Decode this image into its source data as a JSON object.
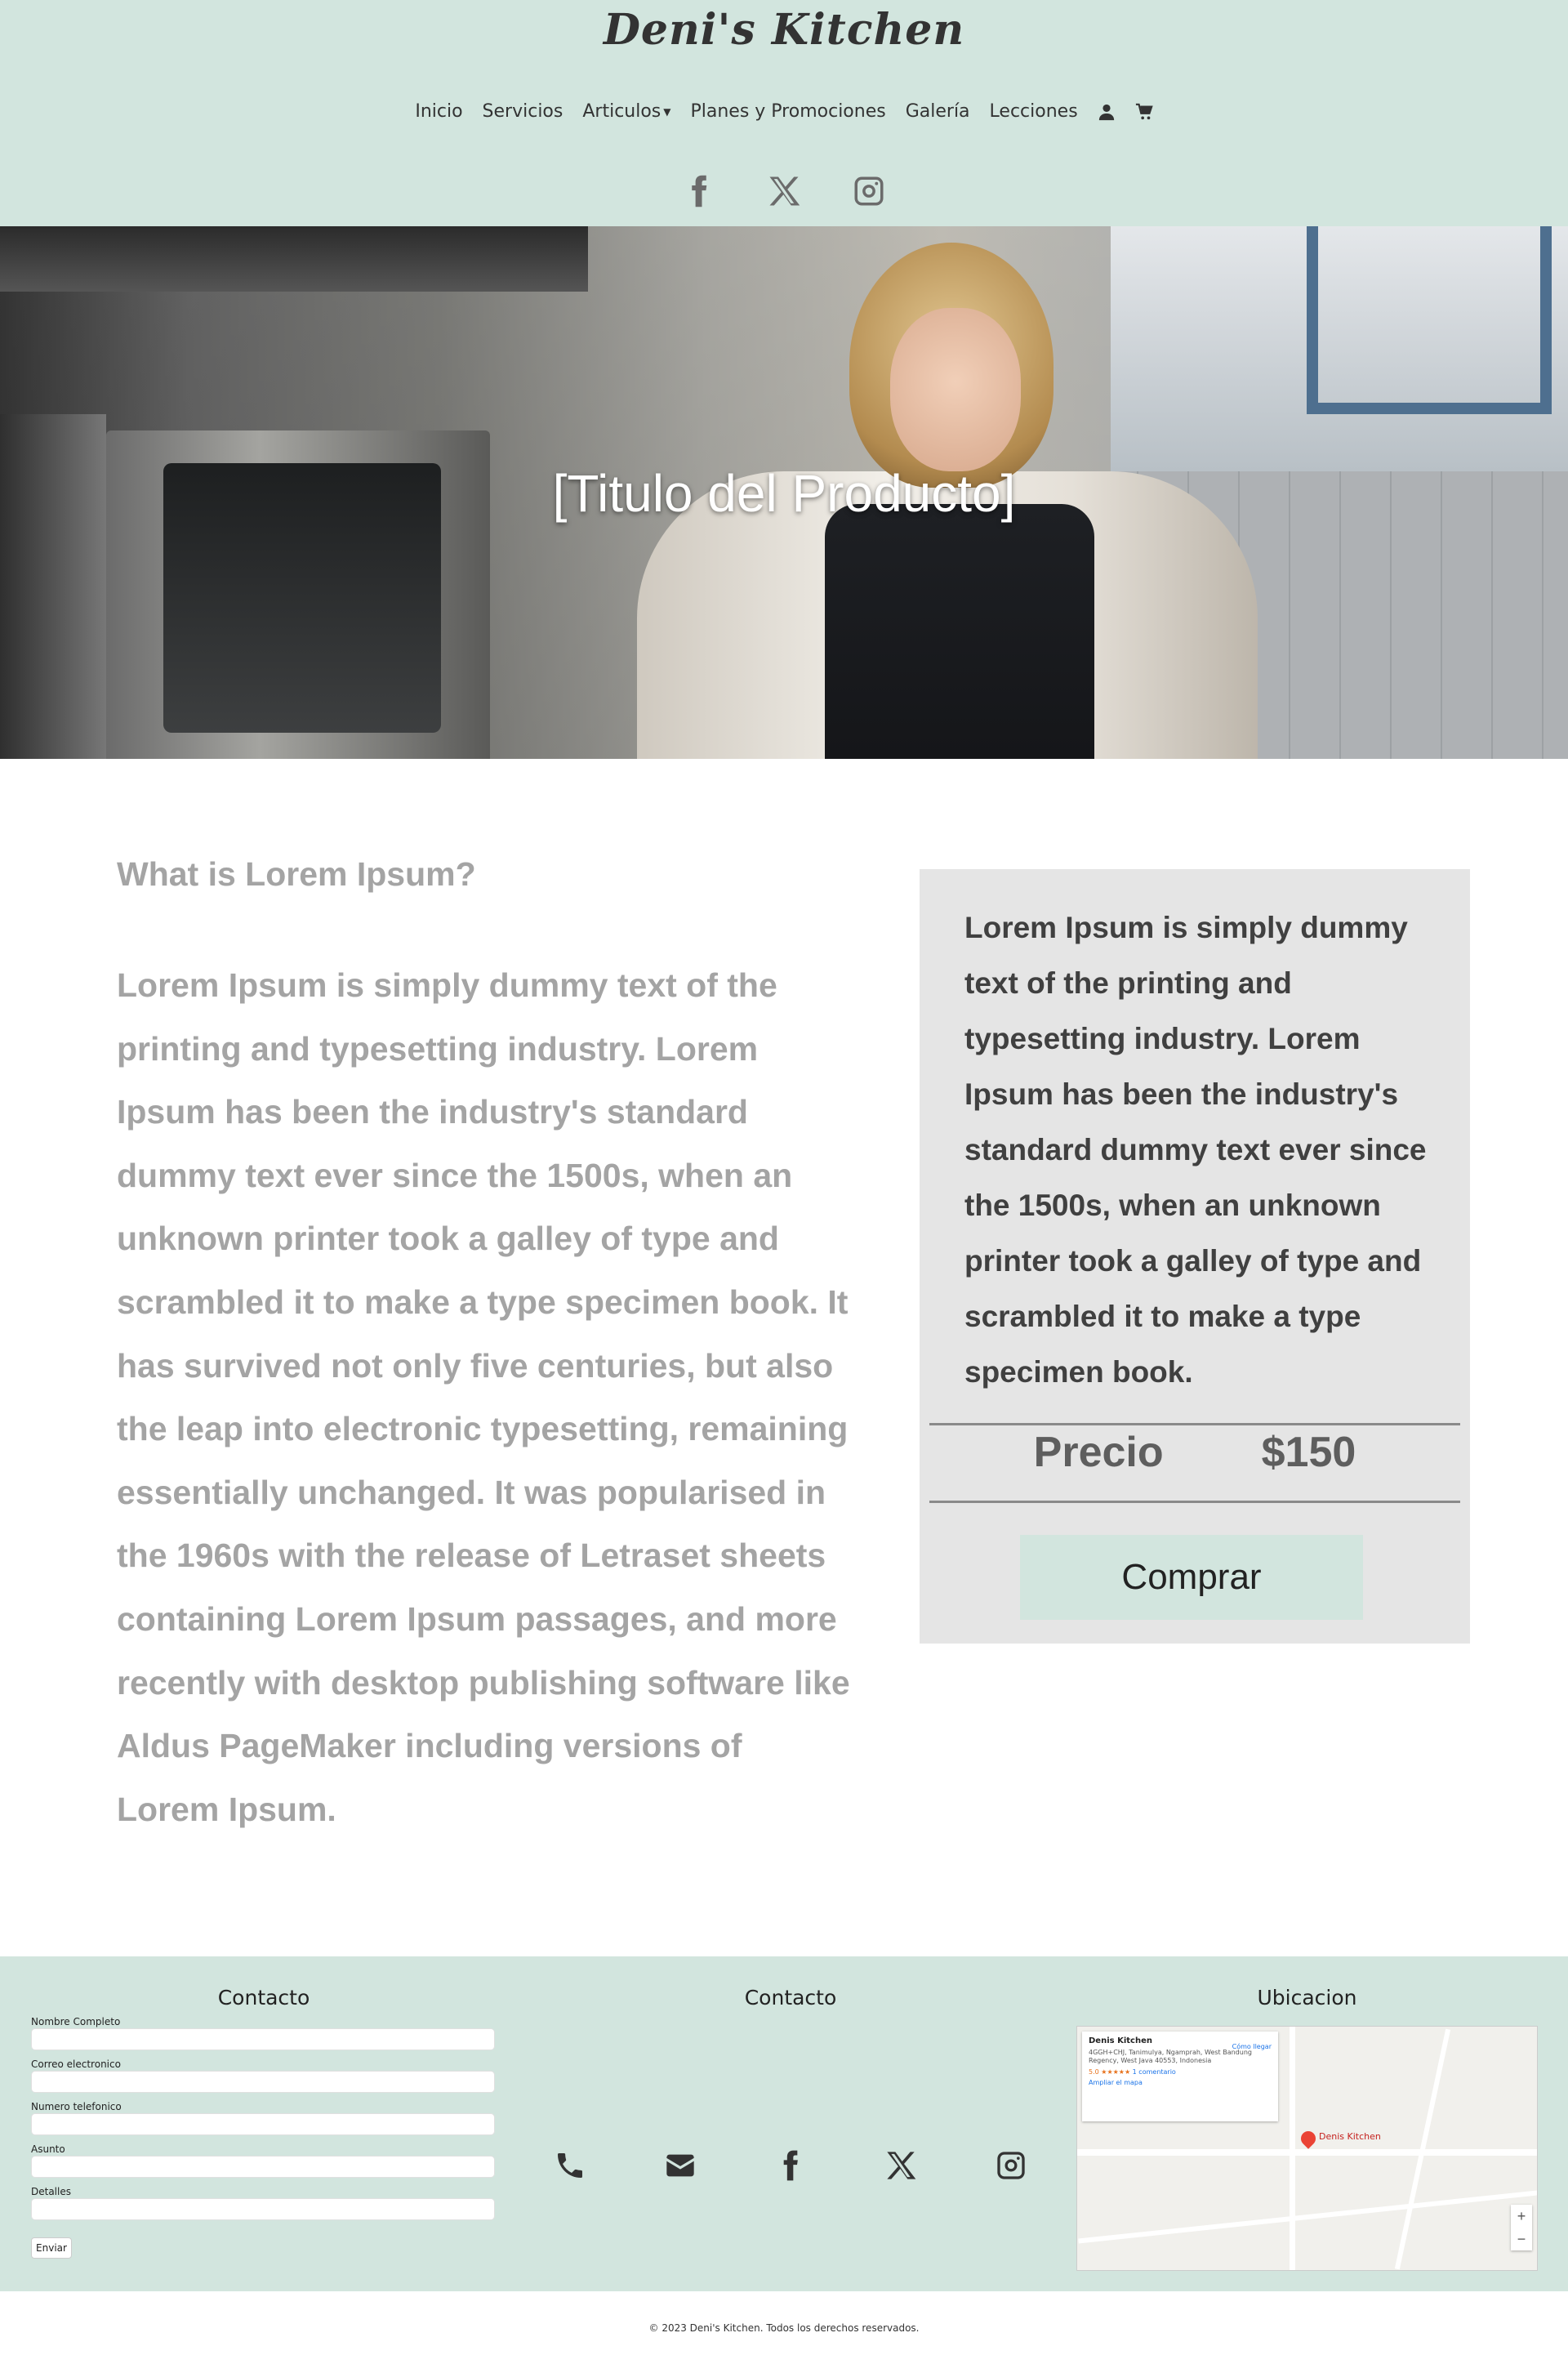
{
  "header": {
    "brand": "Deni's Kitchen",
    "nav": [
      {
        "label": "Inicio"
      },
      {
        "label": "Servicios"
      },
      {
        "label": "Articulos"
      },
      {
        "label": "Planes y Promociones"
      },
      {
        "label": "Galería"
      },
      {
        "label": "Lecciones"
      }
    ],
    "icons": [
      "user-icon",
      "cart-icon"
    ],
    "social": [
      "facebook-icon",
      "x-icon",
      "instagram-icon"
    ]
  },
  "hero": {
    "title": "[Titulo del Producto]"
  },
  "main": {
    "heading": "What is Lorem Ipsum?",
    "body": "Lorem Ipsum is simply dummy text of the printing and typesetting industry. Lorem Ipsum has been the industry's standard dummy text ever since the 1500s, when an unknown printer took a galley of type and scrambled it to make a type specimen book. It has survived not only five centuries, but also the leap into electronic typesetting, remaining essentially unchanged. It was popularised in the 1960s with the release of Letraset sheets containing Lorem Ipsum passages, and more recently with desktop publishing software like Aldus PageMaker including versions of Lorem Ipsum."
  },
  "card": {
    "description": "Lorem Ipsum is simply dummy text of the printing and typesetting industry. Lorem Ipsum has been the industry's standard dummy text ever since the 1500s, when an unknown printer took a galley of type and scrambled it to make a type specimen book.",
    "price_label": "Precio",
    "price_value": "$150",
    "buy_label": "Comprar"
  },
  "footer": {
    "form_title": "Contacto",
    "fields": {
      "name": "Nombre Completo",
      "email": "Correo electronico",
      "phone": "Numero telefonico",
      "subject": "Asunto",
      "details": "Detalles"
    },
    "send_label": "Enviar",
    "contact_title": "Contacto",
    "contact_icons": [
      "phone-icon",
      "envelope-icon",
      "facebook-icon",
      "x-icon",
      "instagram-icon"
    ],
    "location_title": "Ubicacion",
    "map": {
      "place_name": "Denis Kitchen",
      "address": "4GGH+CHJ, Tanimulya, Ngamprah, West Bandung Regency, West Java 40553, Indonesia",
      "rating": "5.0 ★★★★★",
      "reviews": "1 comentario",
      "enlarge": "Ampliar el mapa",
      "directions": "Cómo llegar",
      "pin_label": "Denis Kitchen"
    }
  },
  "copyright": "© 2023 Deni's Kitchen. Todos los derechos reservados."
}
